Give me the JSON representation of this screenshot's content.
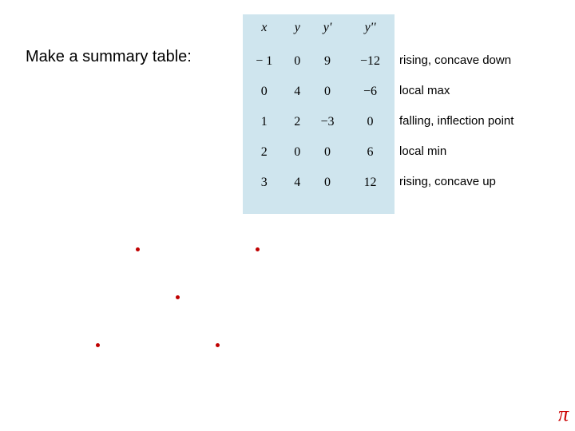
{
  "instruction": "Make a summary table:",
  "table": {
    "headers": [
      "x",
      "y",
      "y'",
      "y''"
    ],
    "rows": [
      [
        "− 1",
        "0",
        "9",
        "−12"
      ],
      [
        "0",
        "4",
        "0",
        "−6"
      ],
      [
        "1",
        "2",
        "−3",
        "0"
      ],
      [
        "2",
        "0",
        "0",
        "6"
      ],
      [
        "3",
        "4",
        "0",
        "12"
      ]
    ]
  },
  "annotations": [
    "rising, concave down",
    "local max",
    "falling, inflection point",
    "local min",
    "rising, concave up"
  ],
  "pi": "π",
  "chart_data": {
    "type": "scatter",
    "title": "",
    "points": [
      {
        "x": -1,
        "y": 0
      },
      {
        "x": 0,
        "y": 4
      },
      {
        "x": 1,
        "y": 2
      },
      {
        "x": 2,
        "y": 0
      },
      {
        "x": 3,
        "y": 4
      }
    ],
    "xlim": [
      -1,
      3
    ],
    "ylim": [
      0,
      4
    ]
  }
}
